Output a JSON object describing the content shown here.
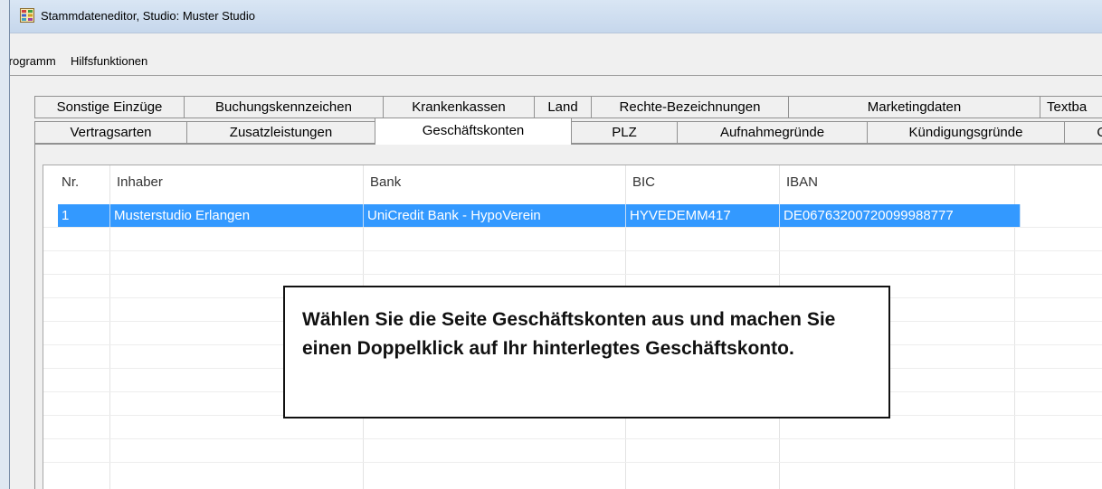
{
  "window": {
    "title": "Stammdateneditor,   Studio: Muster Studio",
    "icon": "database-grid-icon"
  },
  "menu": {
    "items": [
      "Programm",
      "Hilfsfunktionen"
    ]
  },
  "tabs_row1": [
    "Sonstige Einzüge",
    "Buchungskennzeichen",
    "Krankenkassen",
    "Land",
    "Rechte-Bezeichnungen",
    "Marketingdaten",
    "Textba"
  ],
  "tabs_row2": [
    "Vertragsarten",
    "Zusatzleistungen",
    "Geschäftskonten",
    "PLZ",
    "Aufnahmegründe",
    "Kündigungsgründe",
    "O"
  ],
  "active_tab": "Geschäftskonten",
  "table": {
    "columns": [
      "Nr.",
      "Inhaber",
      "Bank",
      "BIC",
      "IBAN"
    ],
    "rows": [
      {
        "nr": "1",
        "inhaber": "Musterstudio Erlangen",
        "bank": "UniCredit Bank - HypoVerein",
        "bic": "HYVEDEMM417",
        "iban": "DE06763200720099988777"
      }
    ]
  },
  "callout": {
    "text": "Wählen Sie die Seite Geschäftskonten aus und machen Sie einen Doppelklick auf Ihr hinterlegtes Geschäftskonto."
  },
  "colors": {
    "selection": "#3399ff",
    "titlebar": "#c6d7ec"
  }
}
